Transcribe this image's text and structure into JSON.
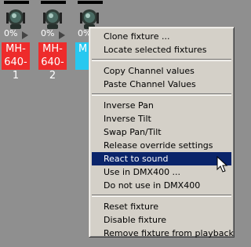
{
  "fixtures": [
    {
      "percent": "0%",
      "label": "MH-\n640-1",
      "color": "#ee2b2b"
    },
    {
      "percent": "0%",
      "label": "MH-\n640-2",
      "color": "#ee2b2b"
    },
    {
      "percent": "0%",
      "label": "M",
      "color": "#27c8f0"
    }
  ],
  "menu": {
    "clone_fixture": "Clone fixture ...",
    "locate_selected": "Locate selected fixtures",
    "copy_channel_values": "Copy Channel values",
    "paste_channel_values": "Paste Channel Values",
    "inverse_pan": "Inverse Pan",
    "inverse_tilt": "Inverse Tilt",
    "swap_pan_tilt": "Swap Pan/Tilt",
    "release_override": "Release override settings",
    "react_to_sound": "React to sound",
    "use_in_dmx400": "Use in DMX400 ...",
    "do_not_use_dmx400": "Do not use in DMX400",
    "reset_fixture": "Reset fixture",
    "disable_fixture": "Disable fixture",
    "remove_from_playback": "Remove fixture from playback"
  },
  "highlighted_item": "React to sound",
  "colors": {
    "highlight": "#0a246a",
    "menu_bg": "#d4d0c8",
    "canvas_bg": "#8f8f8f"
  }
}
